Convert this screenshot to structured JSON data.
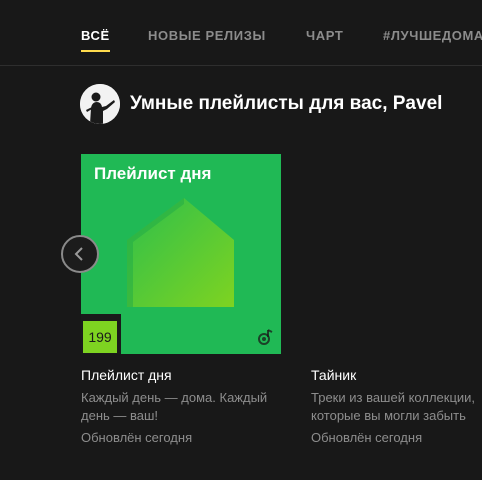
{
  "tabs": [
    {
      "label": "ВСЁ",
      "active": true
    },
    {
      "label": "НОВЫЕ РЕЛИЗЫ",
      "active": false
    },
    {
      "label": "ЧАРТ",
      "active": false
    },
    {
      "label": "#ЛУЧШЕДОМА",
      "active": false
    }
  ],
  "accent_color": "#ffdb4d",
  "section": {
    "title": "Умные плейлисты для вас, Pavel",
    "avatar_icon": "user-avatar"
  },
  "cards": [
    {
      "cover_title": "Плейлист дня",
      "cover_number": "199",
      "cover_color": "#20b955",
      "title": "Плейлист дня",
      "description": "Каждый день — дома. Каждый день — ваш!",
      "updated": "Обновлён сегодня"
    },
    {
      "title": "Тайник",
      "description": "Треки из вашей коллекции, которые вы могли забыть",
      "updated": "Обновлён сегодня"
    }
  ],
  "icons": {
    "prev": "chevron-left-icon",
    "note": "music-note-icon"
  }
}
